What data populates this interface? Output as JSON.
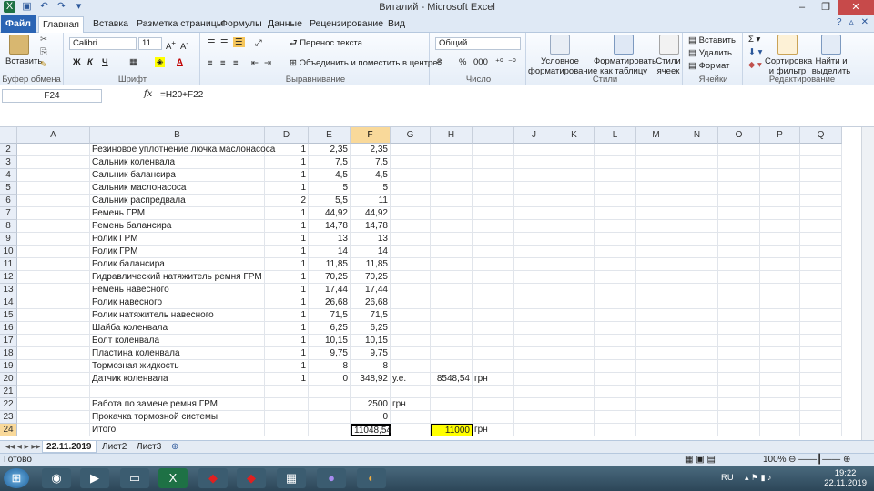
{
  "window": {
    "title": "Виталий  -  Microsoft Excel"
  },
  "tabs": [
    "Файл",
    "Главная",
    "Вставка",
    "Разметка страницы",
    "Формулы",
    "Данные",
    "Рецензирование",
    "Вид"
  ],
  "ribbon": {
    "paste": "Вставить",
    "clipboard_group": "Буфер обмена",
    "font_name": "Calibri",
    "font_size": "11",
    "bold": "Ж",
    "italic": "К",
    "underline": "Ч",
    "font_group": "Шрифт",
    "wrap_text": "Перенос текста",
    "merge_center": "Объединить и поместить в центре",
    "alignment_group": "Выравнивание",
    "number_format": "Общий",
    "number_group": "Число",
    "cond_format": "Условное форматирование",
    "format_table": "Форматировать как таблицу",
    "cell_styles": "Стили ячеек",
    "styles_group": "Стили",
    "insert": "Вставить",
    "delete": "Удалить",
    "format": "Формат",
    "cells_group": "Ячейки",
    "sort_filter": "Сортировка и фильтр",
    "find_select": "Найти и выделить",
    "editing_group": "Редактирование",
    "pct": "%",
    "thousands": "000"
  },
  "formula_bar": {
    "name_box": "F24",
    "fx": "fx",
    "formula": "=H20+F22"
  },
  "columns": [
    "A",
    "B",
    "D",
    "E",
    "F",
    "G",
    "H",
    "I",
    "J",
    "K",
    "L",
    "M",
    "N",
    "O",
    "P",
    "Q"
  ],
  "rows": [
    {
      "n": "2",
      "b": "Резиновое уплотнение лючка маслонасоса",
      "d": "1",
      "e": "2,35",
      "f": "2,35"
    },
    {
      "n": "3",
      "b": "Сальник коленвала",
      "d": "1",
      "e": "7,5",
      "f": "7,5"
    },
    {
      "n": "4",
      "b": "Сальник балансира",
      "d": "1",
      "e": "4,5",
      "f": "4,5"
    },
    {
      "n": "5",
      "b": "Сальник маслонасоса",
      "d": "1",
      "e": "5",
      "f": "5"
    },
    {
      "n": "6",
      "b": "Сальник распредвала",
      "d": "2",
      "e": "5,5",
      "f": "11"
    },
    {
      "n": "7",
      "b": "Ремень ГРМ",
      "d": "1",
      "e": "44,92",
      "f": "44,92"
    },
    {
      "n": "8",
      "b": "Ремень балансира",
      "d": "1",
      "e": "14,78",
      "f": "14,78"
    },
    {
      "n": "9",
      "b": "Ролик ГРМ",
      "d": "1",
      "e": "13",
      "f": "13"
    },
    {
      "n": "10",
      "b": "Ролик ГРМ",
      "d": "1",
      "e": "14",
      "f": "14"
    },
    {
      "n": "11",
      "b": "Ролик балансира",
      "d": "1",
      "e": "11,85",
      "f": "11,85"
    },
    {
      "n": "12",
      "b": "Гидравлический  натяжитель ремня ГРМ",
      "d": "1",
      "e": "70,25",
      "f": "70,25"
    },
    {
      "n": "13",
      "b": "Ремень навесного",
      "d": "1",
      "e": "17,44",
      "f": "17,44"
    },
    {
      "n": "14",
      "b": "Ролик навесного",
      "d": "1",
      "e": "26,68",
      "f": "26,68"
    },
    {
      "n": "15",
      "b": "Ролик натяжитель навесного",
      "d": "1",
      "e": "71,5",
      "f": "71,5"
    },
    {
      "n": "16",
      "b": "Шайба коленвала",
      "d": "1",
      "e": "6,25",
      "f": "6,25"
    },
    {
      "n": "17",
      "b": "Болт коленвала",
      "d": "1",
      "e": "10,15",
      "f": "10,15"
    },
    {
      "n": "18",
      "b": "Пластина коленвала",
      "d": "1",
      "e": "9,75",
      "f": "9,75"
    },
    {
      "n": "19",
      "b": "Тормозная жидкость",
      "d": "1",
      "e": "8",
      "f": "8"
    },
    {
      "n": "20",
      "b": "Датчик коленвала",
      "d": "1",
      "e": "0",
      "f": "348,92",
      "g": "у.е.",
      "h": "8548,54",
      "i": "грн"
    },
    {
      "n": "21",
      "b": ""
    },
    {
      "n": "22",
      "b": "Работа по замене ремня ГРМ",
      "f": "2500",
      "g": "грн"
    },
    {
      "n": "23",
      "b": "Прокачка тормозной системы",
      "f": "0"
    },
    {
      "n": "24",
      "b": "Итого",
      "f": "11048,54",
      "h": "11000",
      "i": "грн"
    }
  ],
  "sheets": [
    "22.11.2019",
    "Лист2",
    "Лист3"
  ],
  "status": {
    "ready": "Готово",
    "zoom": "100%"
  },
  "tray": {
    "lang": "RU",
    "time": "19:22",
    "date": "22.11.2019"
  },
  "colors": {
    "selected_header": "#f9d99a",
    "highlight_cell": "#ffff00",
    "file_tab": "#2a64b4"
  }
}
